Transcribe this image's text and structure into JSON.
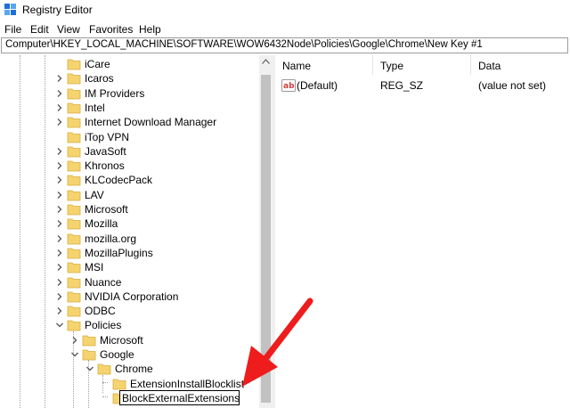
{
  "window": {
    "title": "Registry Editor"
  },
  "menu": [
    "File",
    "Edit",
    "View",
    "Favorites",
    "Help"
  ],
  "address": "Computer\\HKEY_LOCAL_MACHINE\\SOFTWARE\\WOW6432Node\\Policies\\Google\\Chrome\\New Key #1",
  "tree": [
    "iCare",
    "Icaros",
    "IM Providers",
    "Intel",
    "Internet Download Manager",
    "iTop VPN",
    "JavaSoft",
    "Khronos",
    "KLCodecPack",
    "LAV",
    "Microsoft",
    "Mozilla",
    "mozilla.org",
    "MozillaPlugins",
    "MSI",
    "Nuance",
    "NVIDIA Corporation",
    "ODBC",
    "Policies",
    "Microsoft",
    "Google",
    "Chrome",
    "ExtensionInstallBlocklist",
    "BlockExternalExtensions"
  ],
  "columns": {
    "name": "Name",
    "type": "Type",
    "data": "Data"
  },
  "values": [
    {
      "name": "(Default)",
      "type": "REG_SZ",
      "data": "(value not set)"
    }
  ],
  "colors": {
    "folder": "#f5d36e",
    "folder_edge": "#d8ad3c",
    "arrow": "#ee1c1c",
    "icon_red": "#d23b3b"
  }
}
